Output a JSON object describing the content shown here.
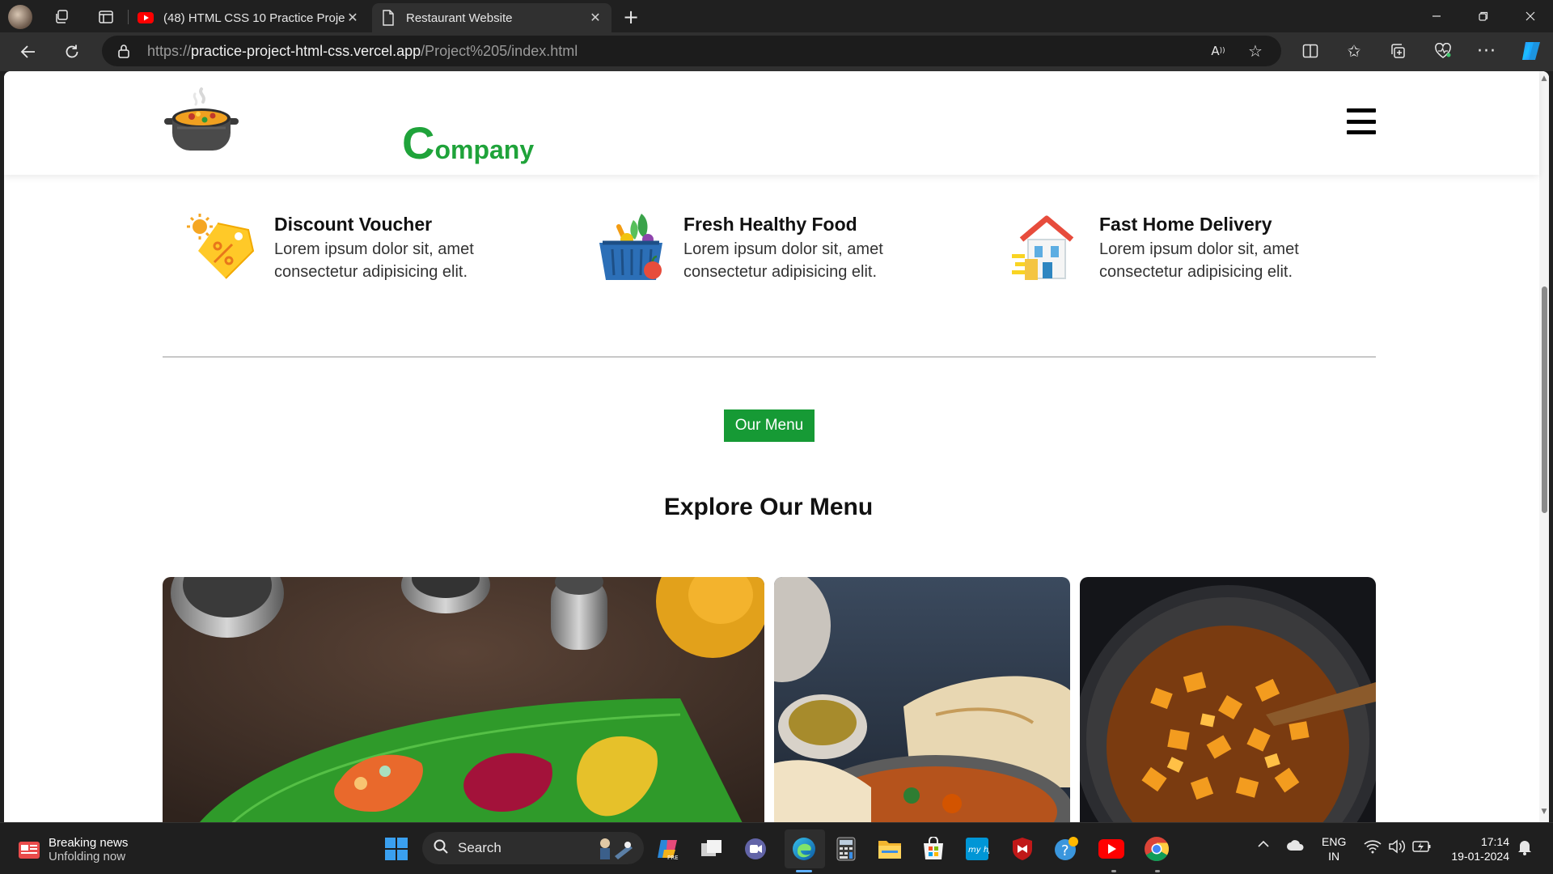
{
  "browser": {
    "tabs": [
      {
        "title": "(48) HTML CSS 10 Practice Projec",
        "favicon": "youtube-icon",
        "active": false
      },
      {
        "title": "Restaurant Website",
        "favicon": "page-icon",
        "active": true
      }
    ],
    "url_scheme": "https://",
    "url_host": "practice-project-html-css.vercel.app",
    "url_path": "/Project%205/index.html"
  },
  "site": {
    "logo_first_letter": "C",
    "logo_rest": "ompany",
    "brand_color": "#1fa33a",
    "features": [
      {
        "icon": "discount-tag-icon",
        "title": "Discount Voucher",
        "desc": "Lorem ipsum dolor sit, amet consectetur adipisicing elit."
      },
      {
        "icon": "food-basket-icon",
        "title": "Fresh Healthy Food",
        "desc": "Lorem ipsum dolor sit, amet consectetur adipisicing elit."
      },
      {
        "icon": "delivery-house-icon",
        "title": "Fast Home Delivery",
        "desc": "Lorem ipsum dolor sit, amet consectetur adipisicing elit."
      }
    ],
    "menu_button": "Our Menu",
    "menu_button_color": "#169a35",
    "explore_title": "Explore Our Menu"
  },
  "taskbar": {
    "news_title": "Breaking news",
    "news_sub": "Unfolding now",
    "search_placeholder": "Search",
    "lang_1": "ENG",
    "lang_2": "IN",
    "time": "17:14",
    "date": "19-01-2024"
  }
}
